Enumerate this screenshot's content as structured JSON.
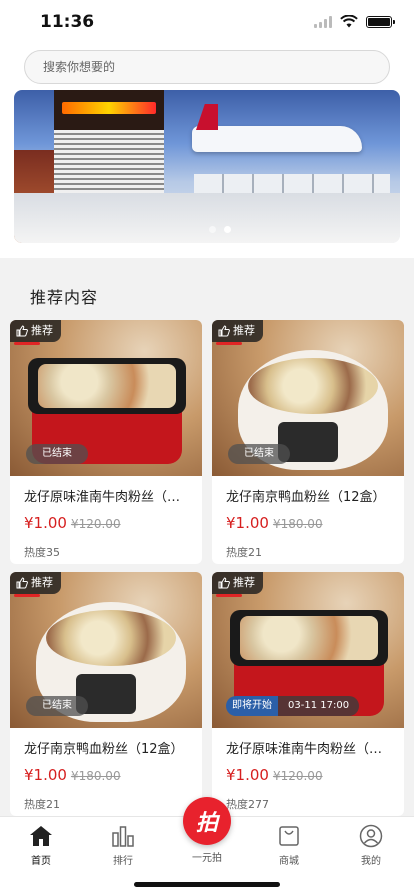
{
  "status_bar": {
    "time": "11:36"
  },
  "search": {
    "placeholder": "搜索你想要的"
  },
  "banner": {
    "page_count": 2,
    "active_page": 2
  },
  "section": {
    "title": "推荐内容"
  },
  "products": [
    {
      "tag": "推荐",
      "status": "已结束",
      "title": "龙仔原味淮南牛肉粉丝（…",
      "price": "¥1.00",
      "original_price": "¥120.00",
      "heat": "热度35",
      "bowl": "red"
    },
    {
      "tag": "推荐",
      "status": "已结束",
      "title": "龙仔南京鸭血粉丝（12盒）",
      "price": "¥1.00",
      "original_price": "¥180.00",
      "heat": "热度21",
      "bowl": "white"
    },
    {
      "tag": "推荐",
      "status": "已结束",
      "title": "龙仔南京鸭血粉丝（12盒）",
      "price": "¥1.00",
      "original_price": "¥180.00",
      "heat": "热度21",
      "bowl": "white"
    },
    {
      "tag": "推荐",
      "status_start": "即将开始",
      "status_time": "03-11 17:00",
      "title": "龙仔原味淮南牛肉粉丝（…",
      "price": "¥1.00",
      "original_price": "¥120.00",
      "heat": "热度277",
      "bowl": "red"
    }
  ],
  "tabbar": {
    "items": [
      {
        "label": "首页",
        "icon": "home-icon",
        "active": true
      },
      {
        "label": "排行",
        "icon": "ranking-icon",
        "active": false
      },
      {
        "label": "一元拍",
        "icon": "auction-icon",
        "center_glyph": "拍",
        "active": false
      },
      {
        "label": "商城",
        "icon": "shopping-bag-icon",
        "active": false
      },
      {
        "label": "我的",
        "icon": "user-icon",
        "active": false
      }
    ]
  },
  "colors": {
    "price": "#d61f1f",
    "center_button": "#e8222d",
    "status_start": "#2b5fa8"
  }
}
